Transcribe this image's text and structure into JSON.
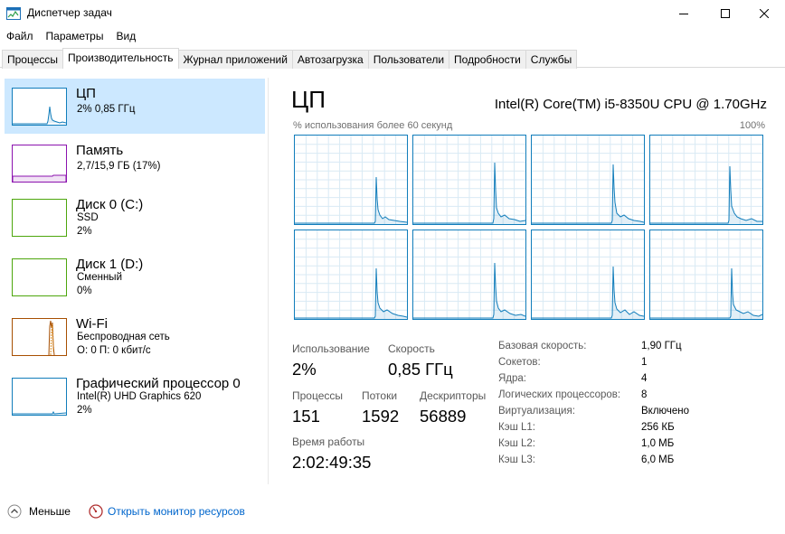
{
  "window": {
    "title": "Диспетчер задач",
    "icons": {
      "app": "task-manager-icon",
      "minimize": "minimize-icon",
      "maximize": "maximize-icon",
      "close": "close-icon"
    }
  },
  "menu": {
    "items": [
      {
        "label": "Файл"
      },
      {
        "label": "Параметры"
      },
      {
        "label": "Вид"
      }
    ]
  },
  "tabs": [
    {
      "label": "Процессы",
      "active": false
    },
    {
      "label": "Производительность",
      "active": true
    },
    {
      "label": "Журнал приложений",
      "active": false
    },
    {
      "label": "Автозагрузка",
      "active": false
    },
    {
      "label": "Пользователи",
      "active": false
    },
    {
      "label": "Подробности",
      "active": false
    },
    {
      "label": "Службы",
      "active": false
    }
  ],
  "sidebar": {
    "items": [
      {
        "name": "ЦП",
        "line1": "2% 0,85 ГГц",
        "line2": "",
        "line3": "",
        "color": "#117dbb",
        "selected": true
      },
      {
        "name": "Память",
        "line1": "2,7/15,9 ГБ (17%)",
        "line2": "",
        "line3": "",
        "color": "#8b12ae",
        "selected": false
      },
      {
        "name": "Диск 0 (C:)",
        "line1": "SSD",
        "line2": "2%",
        "line3": "",
        "color": "#4da60c",
        "selected": false
      },
      {
        "name": "Диск 1 (D:)",
        "line1": "Сменный",
        "line2": "0%",
        "line3": "",
        "color": "#4da60c",
        "selected": false
      },
      {
        "name": "Wi-Fi",
        "line1": "Беспроводная сеть",
        "line2": "О: 0 П: 0 кбит/с",
        "line3": "",
        "color": "#a74f01",
        "selected": false
      },
      {
        "name": "Графический процессор 0",
        "line1": "Intel(R) UHD Graphics 620",
        "line2": "2%",
        "line3": "",
        "color": "#117dbb",
        "selected": false
      }
    ]
  },
  "main": {
    "title": "ЦП",
    "model": "Intel(R) Core(TM) i5-8350U CPU @ 1.70GHz",
    "graph_label": "% использования более 60 секунд",
    "graph_max": "100%",
    "graph_color": "#117dbb",
    "core_count": 8,
    "stats": {
      "usage_label": "Использование",
      "usage_value": "2%",
      "speed_label": "Скорость",
      "speed_value": "0,85 ГГц",
      "processes_label": "Процессы",
      "processes_value": "151",
      "threads_label": "Потоки",
      "threads_value": "1592",
      "handles_label": "Дескрипторы",
      "handles_value": "56889",
      "uptime_label": "Время работы",
      "uptime_value": "2:02:49:35"
    },
    "info": [
      {
        "key": "Базовая скорость:",
        "value": "1,90 ГГц"
      },
      {
        "key": "Сокетов:",
        "value": "1"
      },
      {
        "key": "Ядра:",
        "value": "4"
      },
      {
        "key": "Логических процессоров:",
        "value": "8"
      },
      {
        "key": "Виртуализация:",
        "value": "Включено"
      },
      {
        "key": "Кэш L1:",
        "value": "256 КБ"
      },
      {
        "key": "Кэш L2:",
        "value": "1,0 МБ"
      },
      {
        "key": "Кэш L3:",
        "value": "6,0 МБ"
      }
    ]
  },
  "footer": {
    "less_label": "Меньше",
    "less_icon": "chevron-up-icon",
    "monitor_label": "Открыть монитор ресурсов",
    "monitor_icon": "resource-monitor-icon"
  }
}
